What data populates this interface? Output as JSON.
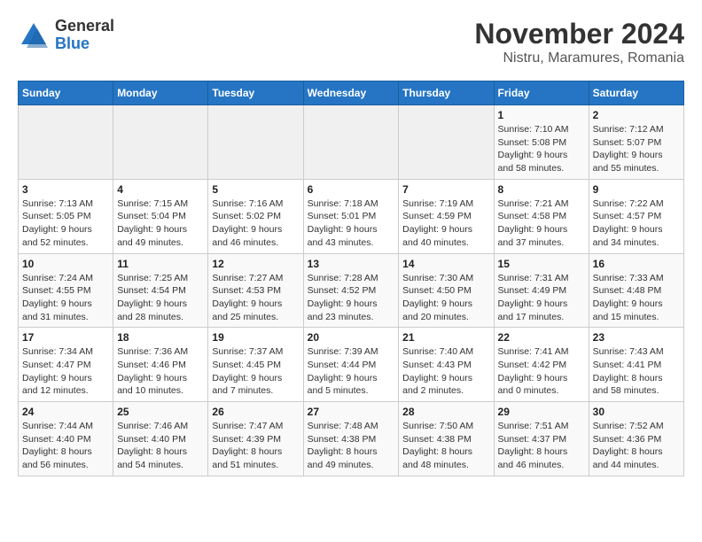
{
  "logo": {
    "general": "General",
    "blue": "Blue"
  },
  "title": "November 2024",
  "subtitle": "Nistru, Maramures, Romania",
  "days_of_week": [
    "Sunday",
    "Monday",
    "Tuesday",
    "Wednesday",
    "Thursday",
    "Friday",
    "Saturday"
  ],
  "weeks": [
    [
      {
        "day": "",
        "info": ""
      },
      {
        "day": "",
        "info": ""
      },
      {
        "day": "",
        "info": ""
      },
      {
        "day": "",
        "info": ""
      },
      {
        "day": "",
        "info": ""
      },
      {
        "day": "1",
        "info": "Sunrise: 7:10 AM\nSunset: 5:08 PM\nDaylight: 9 hours and 58 minutes."
      },
      {
        "day": "2",
        "info": "Sunrise: 7:12 AM\nSunset: 5:07 PM\nDaylight: 9 hours and 55 minutes."
      }
    ],
    [
      {
        "day": "3",
        "info": "Sunrise: 7:13 AM\nSunset: 5:05 PM\nDaylight: 9 hours and 52 minutes."
      },
      {
        "day": "4",
        "info": "Sunrise: 7:15 AM\nSunset: 5:04 PM\nDaylight: 9 hours and 49 minutes."
      },
      {
        "day": "5",
        "info": "Sunrise: 7:16 AM\nSunset: 5:02 PM\nDaylight: 9 hours and 46 minutes."
      },
      {
        "day": "6",
        "info": "Sunrise: 7:18 AM\nSunset: 5:01 PM\nDaylight: 9 hours and 43 minutes."
      },
      {
        "day": "7",
        "info": "Sunrise: 7:19 AM\nSunset: 4:59 PM\nDaylight: 9 hours and 40 minutes."
      },
      {
        "day": "8",
        "info": "Sunrise: 7:21 AM\nSunset: 4:58 PM\nDaylight: 9 hours and 37 minutes."
      },
      {
        "day": "9",
        "info": "Sunrise: 7:22 AM\nSunset: 4:57 PM\nDaylight: 9 hours and 34 minutes."
      }
    ],
    [
      {
        "day": "10",
        "info": "Sunrise: 7:24 AM\nSunset: 4:55 PM\nDaylight: 9 hours and 31 minutes."
      },
      {
        "day": "11",
        "info": "Sunrise: 7:25 AM\nSunset: 4:54 PM\nDaylight: 9 hours and 28 minutes."
      },
      {
        "day": "12",
        "info": "Sunrise: 7:27 AM\nSunset: 4:53 PM\nDaylight: 9 hours and 25 minutes."
      },
      {
        "day": "13",
        "info": "Sunrise: 7:28 AM\nSunset: 4:52 PM\nDaylight: 9 hours and 23 minutes."
      },
      {
        "day": "14",
        "info": "Sunrise: 7:30 AM\nSunset: 4:50 PM\nDaylight: 9 hours and 20 minutes."
      },
      {
        "day": "15",
        "info": "Sunrise: 7:31 AM\nSunset: 4:49 PM\nDaylight: 9 hours and 17 minutes."
      },
      {
        "day": "16",
        "info": "Sunrise: 7:33 AM\nSunset: 4:48 PM\nDaylight: 9 hours and 15 minutes."
      }
    ],
    [
      {
        "day": "17",
        "info": "Sunrise: 7:34 AM\nSunset: 4:47 PM\nDaylight: 9 hours and 12 minutes."
      },
      {
        "day": "18",
        "info": "Sunrise: 7:36 AM\nSunset: 4:46 PM\nDaylight: 9 hours and 10 minutes."
      },
      {
        "day": "19",
        "info": "Sunrise: 7:37 AM\nSunset: 4:45 PM\nDaylight: 9 hours and 7 minutes."
      },
      {
        "day": "20",
        "info": "Sunrise: 7:39 AM\nSunset: 4:44 PM\nDaylight: 9 hours and 5 minutes."
      },
      {
        "day": "21",
        "info": "Sunrise: 7:40 AM\nSunset: 4:43 PM\nDaylight: 9 hours and 2 minutes."
      },
      {
        "day": "22",
        "info": "Sunrise: 7:41 AM\nSunset: 4:42 PM\nDaylight: 9 hours and 0 minutes."
      },
      {
        "day": "23",
        "info": "Sunrise: 7:43 AM\nSunset: 4:41 PM\nDaylight: 8 hours and 58 minutes."
      }
    ],
    [
      {
        "day": "24",
        "info": "Sunrise: 7:44 AM\nSunset: 4:40 PM\nDaylight: 8 hours and 56 minutes."
      },
      {
        "day": "25",
        "info": "Sunrise: 7:46 AM\nSunset: 4:40 PM\nDaylight: 8 hours and 54 minutes."
      },
      {
        "day": "26",
        "info": "Sunrise: 7:47 AM\nSunset: 4:39 PM\nDaylight: 8 hours and 51 minutes."
      },
      {
        "day": "27",
        "info": "Sunrise: 7:48 AM\nSunset: 4:38 PM\nDaylight: 8 hours and 49 minutes."
      },
      {
        "day": "28",
        "info": "Sunrise: 7:50 AM\nSunset: 4:38 PM\nDaylight: 8 hours and 48 minutes."
      },
      {
        "day": "29",
        "info": "Sunrise: 7:51 AM\nSunset: 4:37 PM\nDaylight: 8 hours and 46 minutes."
      },
      {
        "day": "30",
        "info": "Sunrise: 7:52 AM\nSunset: 4:36 PM\nDaylight: 8 hours and 44 minutes."
      }
    ]
  ]
}
